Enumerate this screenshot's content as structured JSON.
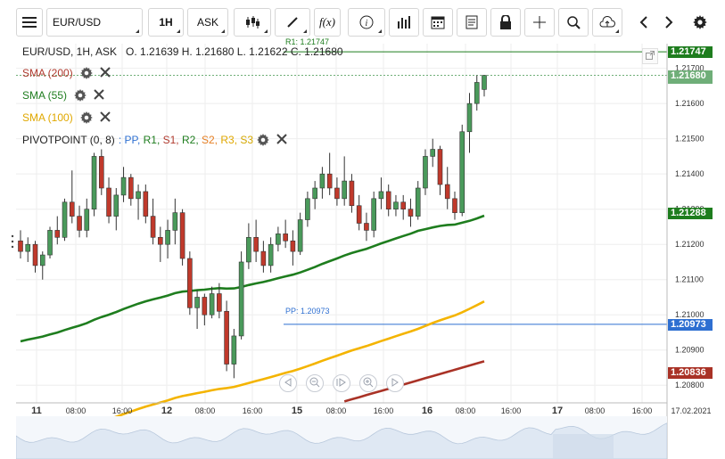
{
  "toolbar": {
    "symbol": "EUR/USD",
    "timeframe": "1H",
    "price_type": "ASK",
    "buttons": [
      "menu-icon",
      "candles-icon",
      "draw-icon",
      "function-icon",
      "info-icon",
      "bar-volume-icon",
      "calendar-icon",
      "notes-icon",
      "lock-icon",
      "crosshair-icon",
      "zoom-icon",
      "cloud-upload-icon",
      "arrow-left-icon",
      "arrow-right-icon",
      "gear-icon"
    ]
  },
  "chart_header": {
    "title": "EUR/USD, 1H, ASK",
    "ohlc": "O. 1.21639 H. 1.21680 L. 1.21622 C. 1.21680"
  },
  "indicators": [
    {
      "label": "SMA (200)",
      "color": "#b03a2e"
    },
    {
      "label": "SMA (55)",
      "color": "#1e7d1e"
    },
    {
      "label": "SMA (100)",
      "color": "#f4b400"
    },
    {
      "label": "PIVOTPOINT (0, 8)",
      "color": "#222222"
    }
  ],
  "pivot_legend": [
    {
      "text": ": PP, ",
      "color": "#2e6fd1"
    },
    {
      "text": "R1, ",
      "color": "#1e7d1e"
    },
    {
      "text": "S1, ",
      "color": "#b03a2e"
    },
    {
      "text": "R2, ",
      "color": "#1e7d1e"
    },
    {
      "text": "S2, ",
      "color": "#e67e22"
    },
    {
      "text": "R3, ",
      "color": "#e0a800"
    },
    {
      "text": "S3",
      "color": "#d4a700"
    }
  ],
  "price_tags": [
    {
      "value": "1.21747",
      "color": "#1e7d1e"
    },
    {
      "value": "1.21680",
      "color": "#6fae78"
    },
    {
      "value": "1.21288",
      "color": "#1e7d1e"
    },
    {
      "value": "1.20973",
      "color": "#2e6fd1"
    },
    {
      "value": "1.20836",
      "color": "#a93226"
    }
  ],
  "pivot_lines": {
    "r1_label": "R1: 1.21747",
    "pp_label": "PP: 1.20973"
  },
  "chart_data": {
    "type": "candlestick",
    "symbol": "EUR/USD",
    "interval": "1H",
    "ylim": [
      1.2075,
      1.2177
    ],
    "y_ticks": [
      "1.21700",
      "1.21600",
      "1.21500",
      "1.21400",
      "1.21300",
      "1.21200",
      "1.21100",
      "1.21000",
      "1.20900",
      "1.20800"
    ],
    "x_ticks": [
      "11",
      "08:00",
      "16:00",
      "12",
      "08:00",
      "16:00",
      "15",
      "08:00",
      "16:00",
      "16",
      "08:00",
      "16:00",
      "17",
      "08:00",
      "16:00",
      "17.02.2021"
    ],
    "pivot_levels": {
      "R1": 1.21747,
      "PP": 1.20973
    },
    "last_close": 1.2168,
    "candles": [
      [
        1.2121,
        1.2124,
        1.2116,
        1.2118
      ],
      [
        1.2118,
        1.2122,
        1.2115,
        1.212
      ],
      [
        1.212,
        1.2121,
        1.2112,
        1.2114
      ],
      [
        1.2114,
        1.2118,
        1.211,
        1.2117
      ],
      [
        1.2117,
        1.2125,
        1.2116,
        1.2124
      ],
      [
        1.2124,
        1.2128,
        1.212,
        1.2122
      ],
      [
        1.2122,
        1.2133,
        1.2121,
        1.2132
      ],
      [
        1.2132,
        1.2141,
        1.2126,
        1.2128
      ],
      [
        1.2128,
        1.2131,
        1.2122,
        1.2124
      ],
      [
        1.2124,
        1.2133,
        1.2122,
        1.213
      ],
      [
        1.213,
        1.2146,
        1.2128,
        1.2145
      ],
      [
        1.2145,
        1.2147,
        1.2134,
        1.2136
      ],
      [
        1.2136,
        1.2139,
        1.2126,
        1.2128
      ],
      [
        1.2128,
        1.2136,
        1.2124,
        1.2134
      ],
      [
        1.2134,
        1.2142,
        1.2132,
        1.2139
      ],
      [
        1.2139,
        1.214,
        1.2131,
        1.2133
      ],
      [
        1.2133,
        1.2137,
        1.2127,
        1.2135
      ],
      [
        1.2135,
        1.2137,
        1.2126,
        1.2128
      ],
      [
        1.2128,
        1.2133,
        1.212,
        1.2122
      ],
      [
        1.2122,
        1.2125,
        1.2115,
        1.212
      ],
      [
        1.212,
        1.2127,
        1.2116,
        1.2124
      ],
      [
        1.2124,
        1.2133,
        1.212,
        1.2129
      ],
      [
        1.2129,
        1.213,
        1.2114,
        1.2116
      ],
      [
        1.2116,
        1.2118,
        1.21,
        1.2102
      ],
      [
        1.2102,
        1.2107,
        1.2096,
        1.2105
      ],
      [
        1.2105,
        1.2106,
        1.2097,
        1.21
      ],
      [
        1.21,
        1.2108,
        1.2099,
        1.2106
      ],
      [
        1.2106,
        1.2109,
        1.2099,
        1.2101
      ],
      [
        1.2101,
        1.2104,
        1.2084,
        1.2086
      ],
      [
        1.2086,
        1.2096,
        1.2082,
        1.2094
      ],
      [
        1.2094,
        1.2118,
        1.2093,
        1.2115
      ],
      [
        1.2115,
        1.2126,
        1.2113,
        1.2122
      ],
      [
        1.2122,
        1.2127,
        1.2115,
        1.2118
      ],
      [
        1.2118,
        1.2121,
        1.2112,
        1.2114
      ],
      [
        1.2114,
        1.2122,
        1.2112,
        1.212
      ],
      [
        1.212,
        1.2125,
        1.2118,
        1.2123
      ],
      [
        1.2123,
        1.2127,
        1.2119,
        1.2121
      ],
      [
        1.2121,
        1.2124,
        1.2114,
        1.2118
      ],
      [
        1.2118,
        1.2129,
        1.2117,
        1.2127
      ],
      [
        1.2127,
        1.2135,
        1.2125,
        1.2133
      ],
      [
        1.2133,
        1.2138,
        1.213,
        1.2136
      ],
      [
        1.2136,
        1.2142,
        1.2133,
        1.214
      ],
      [
        1.214,
        1.2146,
        1.2134,
        1.2136
      ],
      [
        1.2136,
        1.2139,
        1.2131,
        1.2133
      ],
      [
        1.2133,
        1.2145,
        1.2131,
        1.2138
      ],
      [
        1.2138,
        1.214,
        1.2129,
        1.2131
      ],
      [
        1.2131,
        1.2134,
        1.2124,
        1.2126
      ],
      [
        1.2126,
        1.2129,
        1.2121,
        1.2124
      ],
      [
        1.2124,
        1.2135,
        1.2122,
        1.2133
      ],
      [
        1.2133,
        1.2139,
        1.213,
        1.2135
      ],
      [
        1.2135,
        1.2137,
        1.2128,
        1.213
      ],
      [
        1.213,
        1.2134,
        1.2128,
        1.2132
      ],
      [
        1.2132,
        1.2134,
        1.2127,
        1.213
      ],
      [
        1.213,
        1.2133,
        1.2125,
        1.2128
      ],
      [
        1.2128,
        1.2138,
        1.2127,
        1.2136
      ],
      [
        1.2136,
        1.2147,
        1.2134,
        1.2145
      ],
      [
        1.2145,
        1.215,
        1.2142,
        1.2147
      ],
      [
        1.2147,
        1.2148,
        1.2134,
        1.2137
      ],
      [
        1.2137,
        1.2142,
        1.213,
        1.2133
      ],
      [
        1.2133,
        1.2135,
        1.2127,
        1.2129
      ],
      [
        1.2129,
        1.2154,
        1.2128,
        1.2152
      ],
      [
        1.2152,
        1.2163,
        1.2146,
        1.216
      ],
      [
        1.216,
        1.2168,
        1.2158,
        1.2166
      ],
      [
        1.2164,
        1.2168,
        1.2162,
        1.2168
      ]
    ],
    "sma_55": "green trend line",
    "sma_100": "yellow trend line",
    "sma_200": "red trend line"
  },
  "nav_buttons": [
    "prev-icon",
    "zoom-out-icon",
    "reset-icon",
    "zoom-in-icon",
    "next-icon"
  ]
}
